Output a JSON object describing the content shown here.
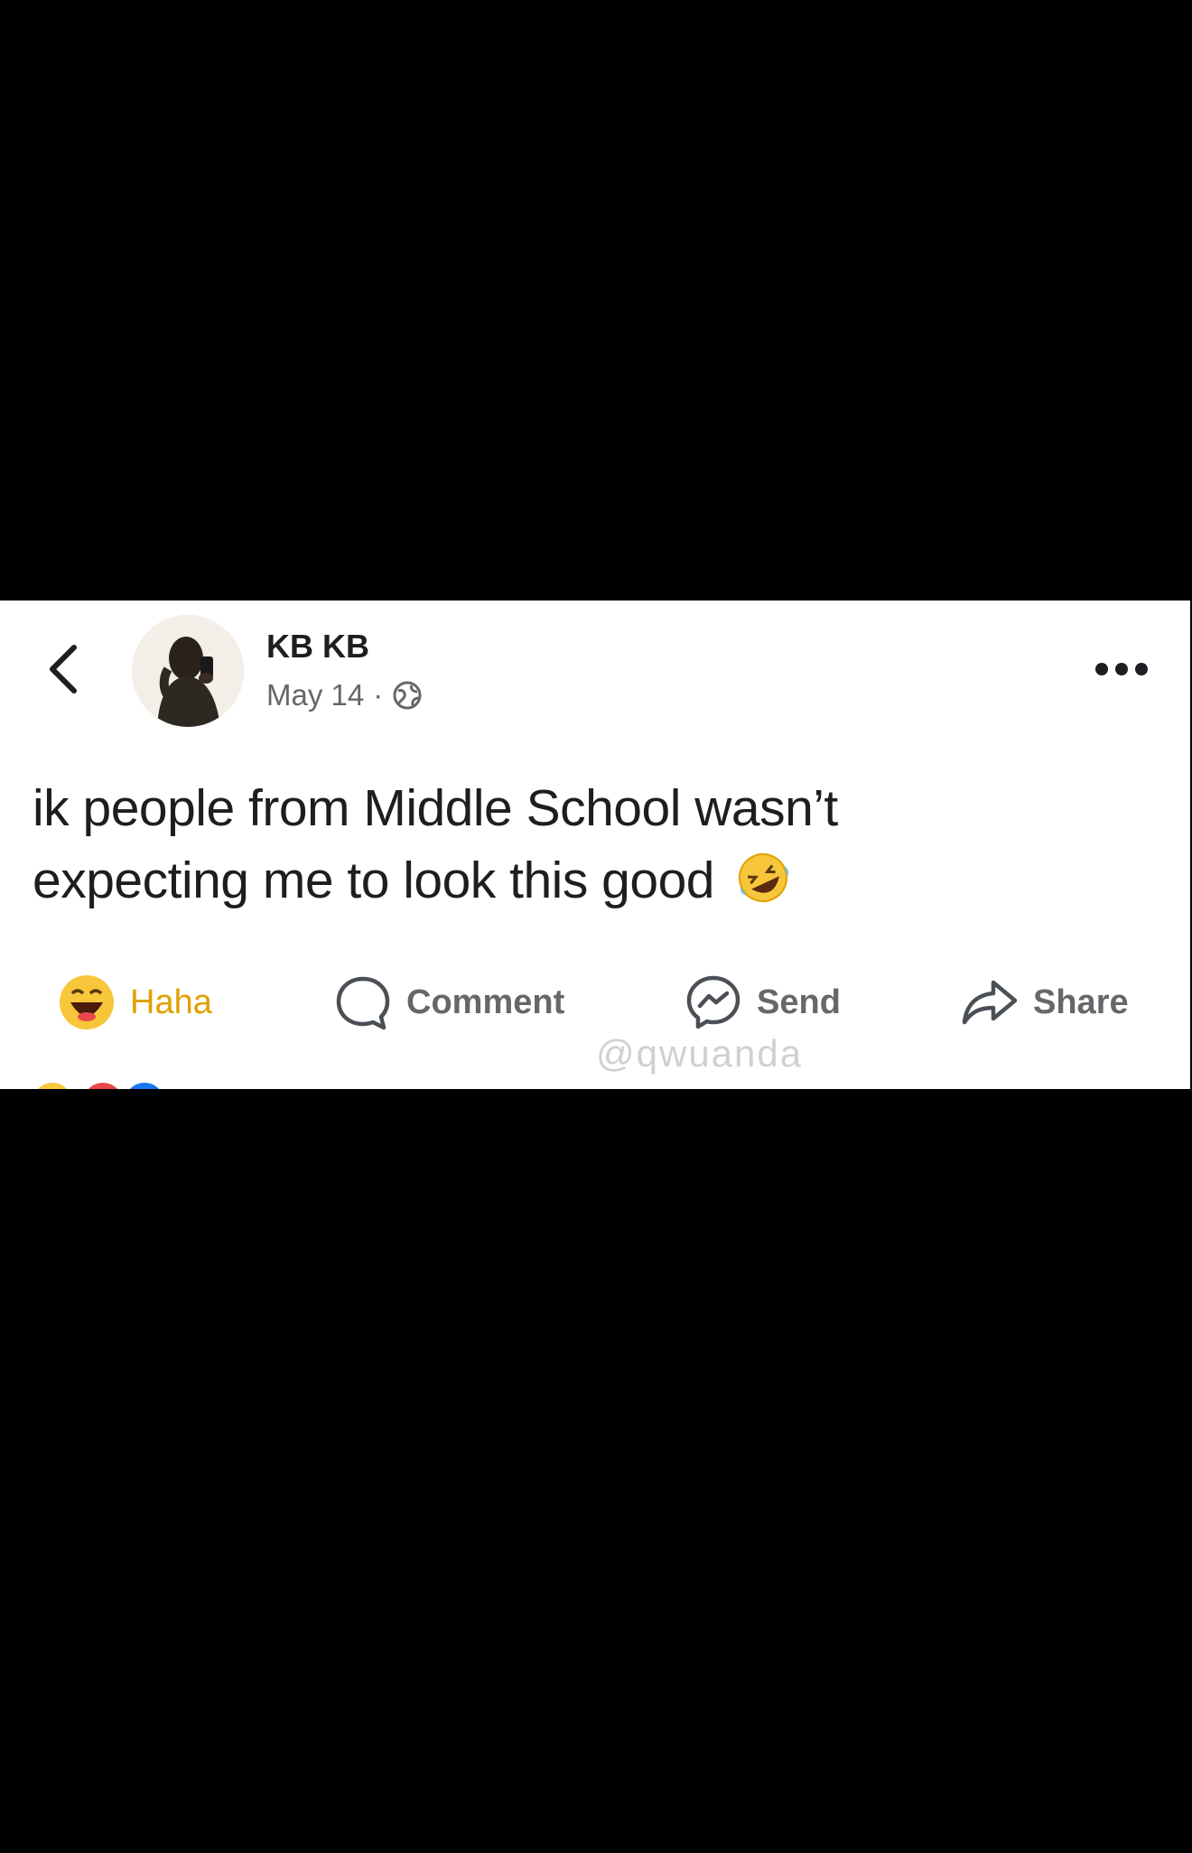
{
  "post": {
    "author_name": "KB KB",
    "date": "May 14",
    "separator": "·",
    "text": "ik people from Middle School wasn’t expecting me to look this good",
    "audience_icon": "globe-icon"
  },
  "actions": {
    "haha_label": "Haha",
    "comment_label": "Comment",
    "send_label": "Send",
    "share_label": "Share"
  },
  "watermark": {
    "text": "@qwuanda"
  },
  "colors": {
    "background": "#000000",
    "card": "#ffffff",
    "text": "#1c1e21",
    "muted": "#65676b",
    "haha": "#e0a100"
  }
}
